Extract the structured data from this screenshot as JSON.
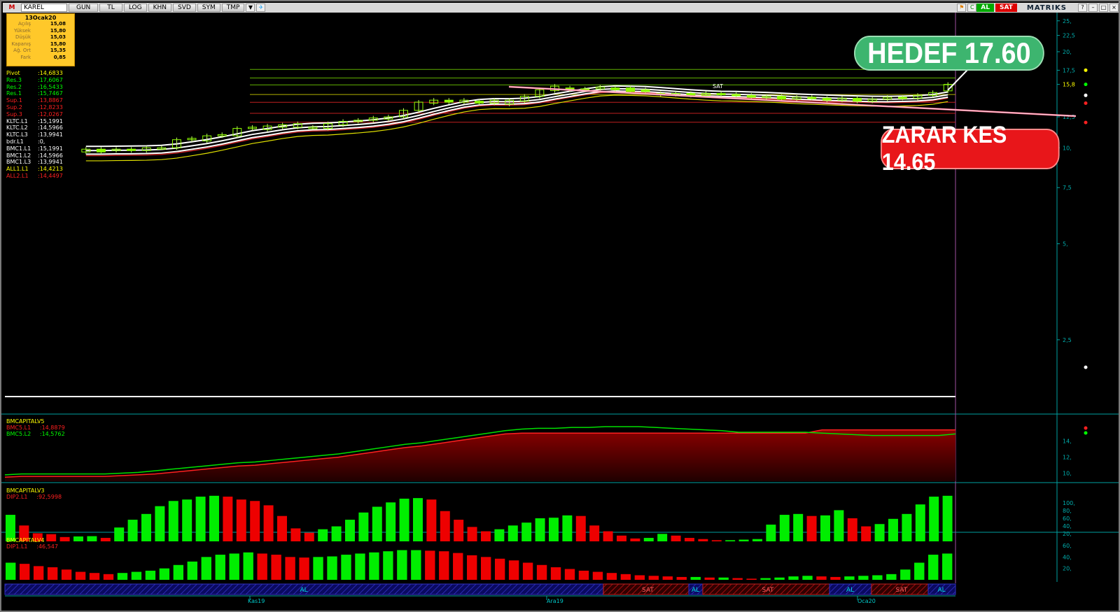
{
  "toolbar": {
    "logo": "M",
    "symbol": "KAREL",
    "buttons": [
      "GUN",
      "TL",
      "LOG",
      "KHN",
      "SVD",
      "SYM",
      "TMP"
    ],
    "al": "AL",
    "sat": "SAT",
    "brand": "MATRIKS"
  },
  "infobox": {
    "date": "13Ocak20",
    "rows": [
      {
        "label": "Açılış",
        "value": "15,08"
      },
      {
        "label": "Yüksek",
        "value": "15,80"
      },
      {
        "label": "Düşük",
        "value": "15,03"
      },
      {
        "label": "Kapanış",
        "value": "15,80"
      },
      {
        "label": "Ağ. Ort",
        "value": "15,35"
      },
      {
        "label": "Fark",
        "value": "0,85"
      }
    ]
  },
  "indicators": [
    {
      "name": "Pivot",
      "value": ":14,6833",
      "color": "#ffff00"
    },
    {
      "name": "Res.3",
      "value": ":17,6067",
      "color": "#00ff00"
    },
    {
      "name": "Res.2",
      "value": ":16,5433",
      "color": "#00ff00"
    },
    {
      "name": "Res.1",
      "value": ":15,7467",
      "color": "#00ff00"
    },
    {
      "name": "Sup.1",
      "value": ":13,8867",
      "color": "#ff2020"
    },
    {
      "name": "Sup.2",
      "value": ":12,8233",
      "color": "#ff2020"
    },
    {
      "name": "Sup.3",
      "value": ":12,0267",
      "color": "#ff2020"
    },
    {
      "name": "KLTC.L1",
      "value": ":15,1991",
      "color": "#ffffff"
    },
    {
      "name": "KLTC.L2",
      "value": ":14,5966",
      "color": "#ffffff"
    },
    {
      "name": "KLTC.L3",
      "value": ":13,9941",
      "color": "#ffffff"
    },
    {
      "name": "bdr.L1",
      "value": ":0,",
      "color": "#ffffff"
    },
    {
      "name": "BMC1.L1",
      "value": ":15,1991",
      "color": "#ffffff"
    },
    {
      "name": "BMC1.L2",
      "value": ":14,5966",
      "color": "#ffffff"
    },
    {
      "name": "BMC1.L3",
      "value": ":13,9941",
      "color": "#ffffff"
    },
    {
      "name": "ALL1.L1",
      "value": ":14,4213",
      "color": "#ffff00"
    },
    {
      "name": "ALL2.L1",
      "value": ":14,4497",
      "color": "#ff2020"
    }
  ],
  "callouts": {
    "target": "HEDEF 17.60",
    "stop": "ZARAR KES 14.65"
  },
  "main_axis": [
    "25,",
    "22,5",
    "20,",
    "17,5",
    "15,8",
    "12,5",
    "10,",
    "7,5",
    "5,",
    "2,5"
  ],
  "sat_marker": "SAT",
  "panel2": {
    "title": "BMCAPITALV5",
    "lines": [
      {
        "name": "BMC5.L1",
        "value": ":14,8879",
        "color": "#ff2020"
      },
      {
        "name": "BMC5.L2",
        "value": ":14,5762",
        "color": "#00ff00"
      }
    ],
    "axis": [
      "14,",
      "12,",
      "10,"
    ]
  },
  "panel3": {
    "title": "BMCAPITALV3",
    "line": {
      "name": "DIP2.L1",
      "value": ":92,5998",
      "color": "#ff2020"
    },
    "axis": [
      "100,",
      "80,",
      "60,",
      "40,",
      "20,"
    ]
  },
  "panel4": {
    "title": "BMCAPITALV4",
    "line": {
      "name": "DIP1.L1",
      "value": ":46,547",
      "color": "#ff2020"
    },
    "axis": [
      "60,",
      "40,",
      "20,"
    ]
  },
  "signals": [
    "AL",
    "SAT",
    "AL",
    "SAT",
    "AL",
    "SAT",
    "AL"
  ],
  "time_labels": [
    "Kas19",
    "Ara19",
    "Oca20"
  ],
  "chart_data": {
    "type": "line",
    "title": "KAREL",
    "candles": [
      {
        "o": 9.7,
        "c": 9.9
      },
      {
        "o": 9.9,
        "c": 9.7
      },
      {
        "o": 9.8,
        "c": 9.9
      },
      {
        "o": 9.9,
        "c": 9.8
      },
      {
        "o": 9.8,
        "c": 10.0
      },
      {
        "o": 10.0,
        "c": 10.0
      },
      {
        "o": 10.0,
        "c": 10.6
      },
      {
        "o": 10.6,
        "c": 10.7
      },
      {
        "o": 10.5,
        "c": 10.9
      },
      {
        "o": 10.9,
        "c": 11.0
      },
      {
        "o": 10.9,
        "c": 11.5
      },
      {
        "o": 11.5,
        "c": 11.6
      },
      {
        "o": 11.4,
        "c": 11.7
      },
      {
        "o": 11.6,
        "c": 11.8
      },
      {
        "o": 11.6,
        "c": 11.9
      },
      {
        "o": 11.6,
        "c": 11.6
      },
      {
        "o": 11.5,
        "c": 11.9
      },
      {
        "o": 11.8,
        "c": 12.1
      },
      {
        "o": 12.1,
        "c": 12.2
      },
      {
        "o": 12.2,
        "c": 12.4
      },
      {
        "o": 12.3,
        "c": 12.5
      },
      {
        "o": 12.5,
        "c": 13.1
      },
      {
        "o": 13.1,
        "c": 13.9
      },
      {
        "o": 13.8,
        "c": 14.1
      },
      {
        "o": 14.1,
        "c": 13.9
      },
      {
        "o": 13.9,
        "c": 14.1
      },
      {
        "o": 14.0,
        "c": 13.8
      },
      {
        "o": 13.8,
        "c": 14.1
      },
      {
        "o": 13.7,
        "c": 14.1
      },
      {
        "o": 14.0,
        "c": 14.5
      },
      {
        "o": 14.5,
        "c": 15.2
      },
      {
        "o": 15.1,
        "c": 15.6
      },
      {
        "o": 15.4,
        "c": 15.2
      },
      {
        "o": 15.3,
        "c": 15.2
      },
      {
        "o": 15.3,
        "c": 15.5
      },
      {
        "o": 15.4,
        "c": 15.2
      },
      {
        "o": 15.4,
        "c": 15.0
      },
      {
        "o": 15.2,
        "c": 15.0
      },
      {
        "o": 14.8,
        "c": 14.7
      },
      {
        "o": 14.7,
        "c": 14.8
      },
      {
        "o": 14.8,
        "c": 14.6
      },
      {
        "o": 14.6,
        "c": 14.8
      },
      {
        "o": 14.8,
        "c": 14.7
      },
      {
        "o": 14.7,
        "c": 14.6
      },
      {
        "o": 14.6,
        "c": 14.4
      },
      {
        "o": 14.4,
        "c": 14.5
      },
      {
        "o": 14.5,
        "c": 14.2
      },
      {
        "o": 14.2,
        "c": 14.4
      },
      {
        "o": 14.4,
        "c": 14.3
      },
      {
        "o": 14.3,
        "c": 14.1
      },
      {
        "o": 14.1,
        "c": 14.3
      },
      {
        "o": 14.3,
        "c": 14.0
      },
      {
        "o": 14.0,
        "c": 14.2
      },
      {
        "o": 14.2,
        "c": 14.4
      },
      {
        "o": 14.4,
        "c": 14.3
      },
      {
        "o": 14.3,
        "c": 14.6
      },
      {
        "o": 14.6,
        "c": 14.9
      },
      {
        "o": 15.08,
        "c": 15.8
      }
    ],
    "levels": {
      "res3": 17.6067,
      "res2": 16.5433,
      "res1": 15.7467,
      "pivot": 14.6833,
      "sup1": 13.8867,
      "sup2": 12.8233,
      "sup3": 12.0267
    },
    "ylim": [
      1.5,
      26
    ],
    "v5_red": [
      9.5,
      9.6,
      9.6,
      9.6,
      9.6,
      9.6,
      9.6,
      9.7,
      9.8,
      9.9,
      10.1,
      10.3,
      10.5,
      10.7,
      10.9,
      11.0,
      11.2,
      11.4,
      11.6,
      11.8,
      12.0,
      12.3,
      12.6,
      12.9,
      13.2,
      13.4,
      13.7,
      14.0,
      14.3,
      14.6,
      14.9,
      15.0,
      15.0,
      15.0,
      15.0,
      15.0,
      15.0,
      15.0,
      15.0,
      15.0,
      15.0,
      15.0,
      15.0,
      15.0,
      15.0,
      15.0,
      15.0,
      15.0,
      15.0,
      15.4,
      15.4,
      15.4,
      15.4,
      15.4,
      15.4,
      15.4,
      15.4,
      15.4
    ],
    "v5_green": [
      9.8,
      9.9,
      9.9,
      9.9,
      9.9,
      9.9,
      9.9,
      10.0,
      10.1,
      10.3,
      10.5,
      10.7,
      10.9,
      11.1,
      11.3,
      11.4,
      11.6,
      11.8,
      12.0,
      12.2,
      12.4,
      12.7,
      13.0,
      13.3,
      13.6,
      13.8,
      14.1,
      14.4,
      14.7,
      15.0,
      15.3,
      15.5,
      15.6,
      15.6,
      15.7,
      15.7,
      15.8,
      15.8,
      15.8,
      15.7,
      15.6,
      15.5,
      15.4,
      15.3,
      15.1,
      15.1,
      15.1,
      15.1,
      15.1,
      15.0,
      14.9,
      14.8,
      14.7,
      14.7,
      14.7,
      14.7,
      14.7,
      14.9
    ],
    "v3": [
      92,
      55,
      28,
      25,
      15,
      17,
      18,
      12,
      48,
      75,
      95,
      122,
      140,
      145,
      155,
      158,
      155,
      145,
      140,
      125,
      88,
      45,
      30,
      42,
      52,
      75,
      100,
      120,
      135,
      148,
      150,
      145,
      105,
      75,
      50,
      35,
      42,
      55,
      65,
      80,
      82,
      90,
      88,
      55,
      35,
      20,
      10,
      12,
      26,
      20,
      12,
      8,
      4,
      4,
      6,
      8,
      58,
      92,
      95,
      88,
      90,
      108,
      80,
      52,
      60,
      78,
      95,
      128,
      155,
      158
    ],
    "v4": [
      30,
      28,
      24,
      22,
      18,
      14,
      12,
      10,
      12,
      14,
      16,
      20,
      26,
      32,
      40,
      44,
      46,
      48,
      46,
      44,
      40,
      39,
      40,
      41,
      44,
      46,
      48,
      50,
      52,
      52,
      51,
      50,
      47,
      43,
      40,
      37,
      34,
      30,
      26,
      22,
      19,
      16,
      14,
      12,
      10,
      8,
      7,
      6,
      5,
      5,
      4,
      4,
      3,
      2,
      3,
      4,
      6,
      7,
      6,
      5,
      6,
      7,
      8,
      10,
      18,
      30,
      44,
      46
    ]
  }
}
